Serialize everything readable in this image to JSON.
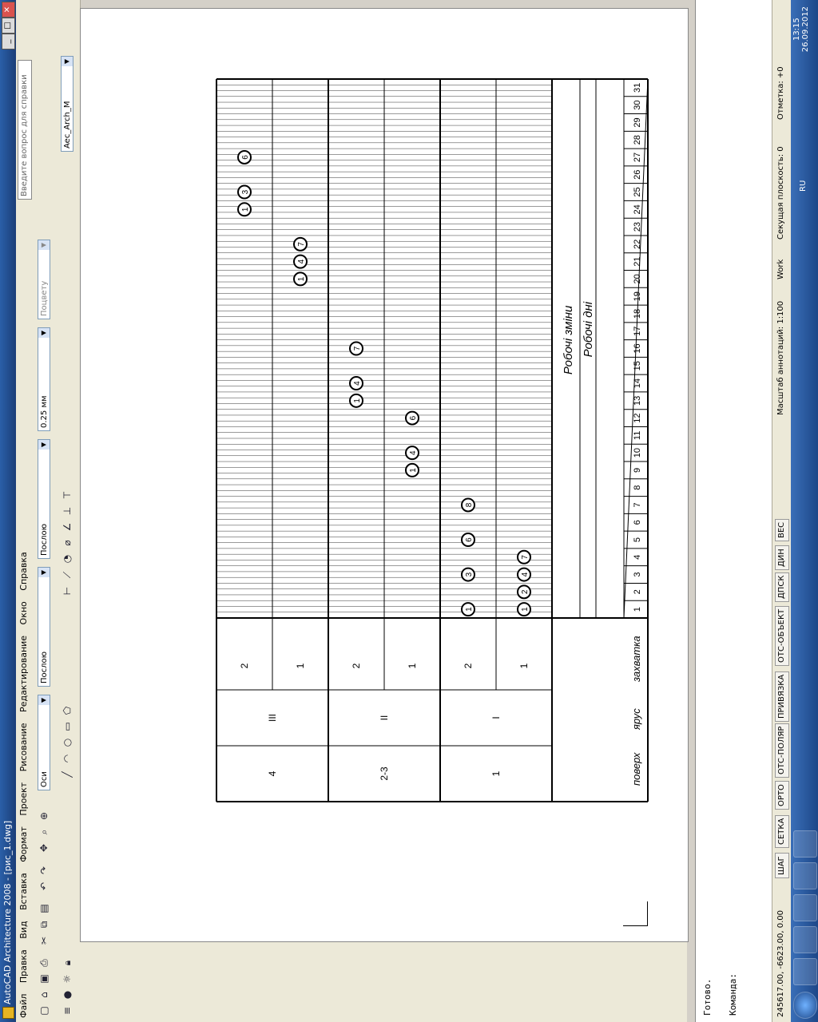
{
  "window": {
    "title": "AutoCAD Architecture 2008 - [рис_1.dwg]",
    "help_placeholder": "Введите вопрос для справки"
  },
  "menu": [
    "Файл",
    "Правка",
    "Вид",
    "Вставка",
    "Формат",
    "Проект",
    "Рисование",
    "Редактирование",
    "Окно",
    "Справка"
  ],
  "toolbar": {
    "layer_combo": "Оси",
    "color_combo": "Послою",
    "linetype_combo": "Послою",
    "lineweight_combo": "0.25 мм",
    "plotstyle_combo": "Поцвету",
    "style_combo": "Aec_Arch_M"
  },
  "chart": {
    "header_labels": {
      "floor": "поверх",
      "tier": "ярус",
      "grip": "захватка"
    },
    "floors": [
      "1",
      "2-3",
      "4"
    ],
    "tiers": [
      "I",
      "II",
      "III"
    ],
    "grips": [
      "1",
      "2",
      "1",
      "2",
      "1",
      "2"
    ],
    "shifts_label": "Робочі зміни",
    "days_label": "Робочі дні",
    "days": [
      "1",
      "2",
      "3",
      "4",
      "5",
      "6",
      "7",
      "8",
      "9",
      "10",
      "11",
      "12",
      "13",
      "14",
      "15",
      "16",
      "17",
      "18",
      "19",
      "20",
      "21",
      "22",
      "23",
      "24",
      "25",
      "26",
      "27",
      "28",
      "29",
      "30",
      "31"
    ],
    "process_markers": [
      {
        "row": 0,
        "day": 1,
        "label": "1"
      },
      {
        "row": 0,
        "day": 2,
        "label": "2"
      },
      {
        "row": 0,
        "day": 3,
        "label": "4"
      },
      {
        "row": 0,
        "day": 4,
        "label": "7"
      },
      {
        "row": 1,
        "day": 1,
        "label": "1"
      },
      {
        "row": 1,
        "day": 3,
        "label": "3"
      },
      {
        "row": 1,
        "day": 5,
        "label": "6"
      },
      {
        "row": 1,
        "day": 7,
        "label": "8"
      },
      {
        "row": 2,
        "day": 9,
        "label": "1"
      },
      {
        "row": 2,
        "day": 10,
        "label": "4"
      },
      {
        "row": 2,
        "day": 12,
        "label": "6"
      },
      {
        "row": 3,
        "day": 13,
        "label": "1"
      },
      {
        "row": 3,
        "day": 14,
        "label": "4"
      },
      {
        "row": 3,
        "day": 16,
        "label": "7"
      },
      {
        "row": 4,
        "day": 20,
        "label": "1"
      },
      {
        "row": 4,
        "day": 21,
        "label": "4"
      },
      {
        "row": 4,
        "day": 22,
        "label": "7"
      },
      {
        "row": 5,
        "day": 24,
        "label": "1"
      },
      {
        "row": 5,
        "day": 25,
        "label": "3"
      },
      {
        "row": 5,
        "day": 27,
        "label": "6"
      }
    ]
  },
  "command": {
    "line1": "Готово.",
    "prompt": "Команда:"
  },
  "status": {
    "coords": "245617.00, -6623.00, 0.00",
    "toggles": [
      "ШАГ",
      "СЕТКА",
      "ОРТО",
      "ОТС-ПОЛЯР",
      "ПРИВЯЗКА",
      "ОТС-ОБЪЕКТ",
      "ДПСК",
      "ДИН",
      "ВЕС"
    ],
    "scale_label": "Масштаб аннотаций: 1:100",
    "workspace": "Work",
    "section_plane": "Секущая плоскость: 0",
    "elevation": "Отметка: +0"
  },
  "taskbar": {
    "lang": "RU",
    "time": "13:15",
    "date": "26.09.2012"
  }
}
